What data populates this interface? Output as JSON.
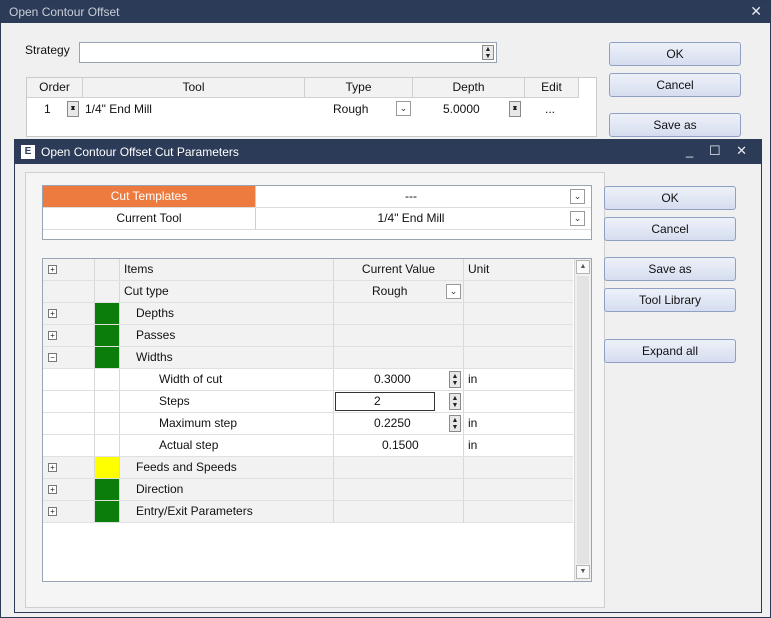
{
  "back_dialog": {
    "title": "Open Contour Offset",
    "close_glyph": "✕",
    "strategy_label": "Strategy",
    "strategy_value": "",
    "table": {
      "headers": [
        "Order",
        "Tool",
        "Type",
        "Depth",
        "Edit"
      ],
      "row": {
        "order": "1",
        "tool": "1/4\" End Mill",
        "type": "Rough",
        "depth": "5.0000",
        "edit": "..."
      }
    },
    "buttons": {
      "ok": "OK",
      "cancel": "Cancel",
      "save_as": "Save as"
    }
  },
  "front_dialog": {
    "icon_letter": "E",
    "title": "Open Contour Offset Cut Parameters",
    "window_controls": "_ ☐ ✕",
    "templates": [
      {
        "key": "Cut Templates",
        "value": "---",
        "key_bg": "#ed7b3f",
        "key_color": "#ffffff"
      },
      {
        "key": "Current Tool",
        "value": "1/4\" End Mill",
        "key_bg": "#ffffff",
        "key_color": "#111111"
      }
    ],
    "grid": {
      "header": {
        "items": "Items",
        "current_value": "Current Value",
        "unit": "Unit"
      },
      "rows": [
        {
          "name": "Cut type",
          "value": "Rough",
          "unit": "",
          "expander": "",
          "color": "",
          "indent": 0,
          "dropdown": true,
          "spinner": false,
          "boxed": false
        },
        {
          "name": "Depths",
          "value": "",
          "unit": "",
          "expander": "+",
          "color": "#0a7d0a",
          "indent": 1,
          "dropdown": false,
          "spinner": false,
          "boxed": false
        },
        {
          "name": "Passes",
          "value": "",
          "unit": "",
          "expander": "+",
          "color": "#0a7d0a",
          "indent": 1,
          "dropdown": false,
          "spinner": false,
          "boxed": false
        },
        {
          "name": "Widths",
          "value": "",
          "unit": "",
          "expander": "−",
          "color": "#0a7d0a",
          "indent": 1,
          "dropdown": false,
          "spinner": false,
          "boxed": false
        },
        {
          "name": "Width of cut",
          "value": "0.3000",
          "unit": "in",
          "expander": "",
          "color": "",
          "indent": 2,
          "dropdown": false,
          "spinner": true,
          "boxed": false
        },
        {
          "name": "Steps",
          "value": "2",
          "unit": "",
          "expander": "",
          "color": "",
          "indent": 2,
          "dropdown": false,
          "spinner": true,
          "boxed": true
        },
        {
          "name": "Maximum step",
          "value": "0.2250",
          "unit": "in",
          "expander": "",
          "color": "",
          "indent": 2,
          "dropdown": false,
          "spinner": true,
          "boxed": false
        },
        {
          "name": "Actual step",
          "value": "0.1500",
          "unit": "in",
          "expander": "",
          "color": "",
          "indent": 2,
          "dropdown": false,
          "spinner": false,
          "boxed": false
        },
        {
          "name": "Feeds and Speeds",
          "value": "",
          "unit": "",
          "expander": "+",
          "color": "#ffff00",
          "indent": 1,
          "dropdown": false,
          "spinner": false,
          "boxed": false
        },
        {
          "name": "Direction",
          "value": "",
          "unit": "",
          "expander": "+",
          "color": "#0a7d0a",
          "indent": 1,
          "dropdown": false,
          "spinner": false,
          "boxed": false
        },
        {
          "name": "Entry/Exit Parameters",
          "value": "",
          "unit": "",
          "expander": "+",
          "color": "#0a7d0a",
          "indent": 1,
          "dropdown": false,
          "spinner": false,
          "boxed": false
        }
      ]
    },
    "buttons": {
      "ok": "OK",
      "cancel": "Cancel",
      "save_as": "Save as",
      "tool_library": "Tool Library",
      "expand_all": "Expand all"
    }
  },
  "glyphs": {
    "expand": "+",
    "spin_up": "▲",
    "spin_down": "▼",
    "dropdown": "⌄",
    "scroll_up": "▲",
    "scroll_down": "▼"
  }
}
